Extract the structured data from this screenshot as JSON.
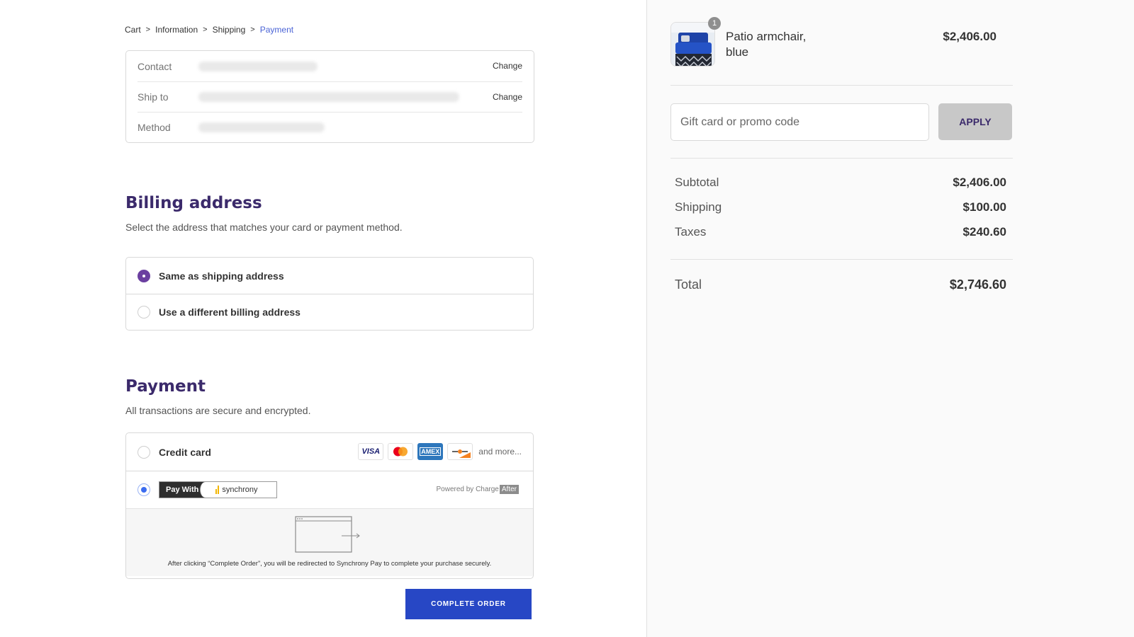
{
  "breadcrumb": {
    "items": [
      "Cart",
      "Information",
      "Shipping",
      "Payment"
    ],
    "separator": ">"
  },
  "review": {
    "rows": [
      {
        "label": "Contact",
        "action": "Change"
      },
      {
        "label": "Ship to",
        "action": "Change"
      },
      {
        "label": "Method"
      }
    ]
  },
  "billing": {
    "title": "Billing address",
    "subtitle": "Select the address that matches your card or payment method.",
    "options": [
      "Same as shipping address",
      "Use a different billing address"
    ],
    "selected_index": 0
  },
  "payment": {
    "title": "Payment",
    "subtitle": "All transactions are secure and encrypted.",
    "credit_card_label": "Credit card",
    "card_brands": [
      "VISA",
      "mastercard-icon",
      "AMEX",
      "discover-icon"
    ],
    "and_more": "and more...",
    "pay_with_label": "Pay With",
    "synchrony_label": "synchrony",
    "powered_by": "Powered by Charge",
    "powered_by_badge": "After",
    "redirect_text": "After clicking “Complete Order”, you will be redirected to Synchrony Pay to complete your purchase securely.",
    "selected": "synchrony"
  },
  "complete_order_label": "COMPLETE ORDER",
  "summary": {
    "product": {
      "name": "Patio armchair, blue",
      "quantity": "1",
      "price": "$2,406.00"
    },
    "promo_placeholder": "Gift card or promo code",
    "apply_label": "APPLY",
    "subtotal_label": "Subtotal",
    "subtotal_value": "$2,406.00",
    "shipping_label": "Shipping",
    "shipping_value": "$100.00",
    "taxes_label": "Taxes",
    "taxes_value": "$240.60",
    "total_label": "Total",
    "total_value": "$2,746.60"
  },
  "colors": {
    "heading": "#3b2a6b",
    "active_breadcrumb": "#4a63d6",
    "radio_purple": "#6b3fa0",
    "radio_blue": "#3b6cf0",
    "complete_button": "#2747c5",
    "apply_button_bg": "#c8c8c8"
  }
}
